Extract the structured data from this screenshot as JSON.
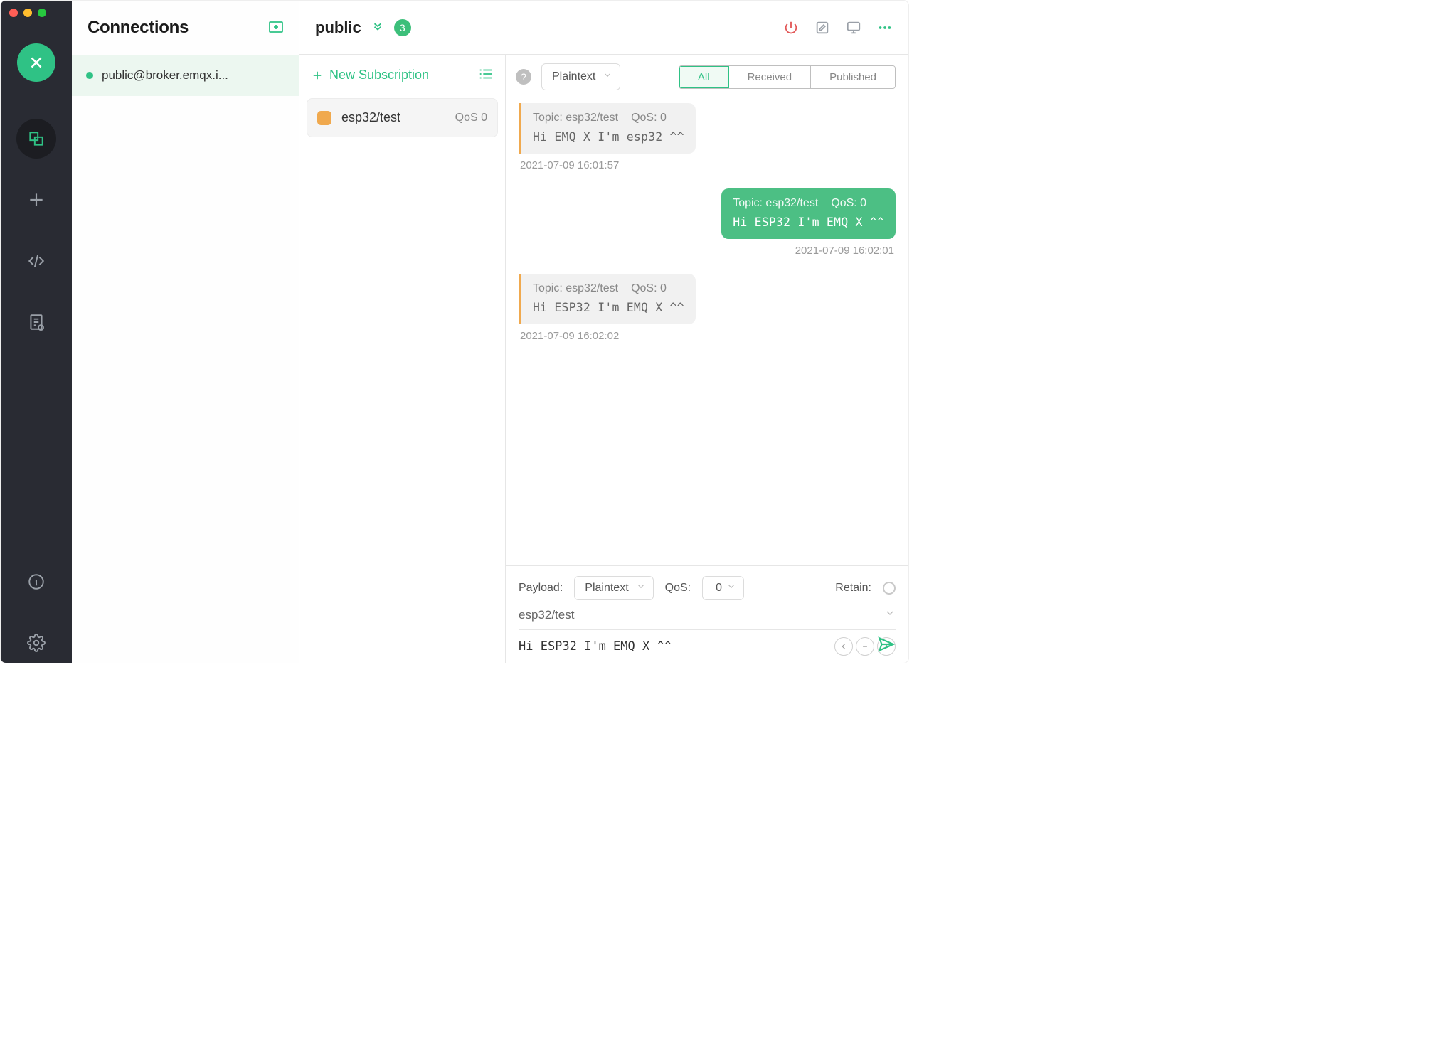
{
  "window": {
    "title": "Connections"
  },
  "sidebar": {
    "connections": [
      {
        "name": "public@broker.emqx.i...",
        "online": true,
        "active": true
      }
    ]
  },
  "topbar": {
    "title": "public",
    "unread": 3,
    "actions": {
      "disconnect": "Disconnect",
      "edit": "Edit",
      "display": "Display",
      "more": "More"
    }
  },
  "subscriptions": {
    "new_label": "New Subscription",
    "items": [
      {
        "topic": "esp32/test",
        "qos_label": "QoS 0",
        "color": "#f0a94e"
      }
    ]
  },
  "message_toolbar": {
    "format_select": "Plaintext",
    "segments": {
      "all": "All",
      "received": "Received",
      "published": "Published"
    },
    "active_segment": "all"
  },
  "messages": [
    {
      "direction": "in",
      "topic_label": "Topic: esp32/test",
      "qos_label": "QoS: 0",
      "payload": "Hi EMQ X I'm esp32 ^^",
      "timestamp": "2021-07-09 16:01:57"
    },
    {
      "direction": "out",
      "topic_label": "Topic: esp32/test",
      "qos_label": "QoS: 0",
      "payload": "Hi ESP32 I'm EMQ X ^^",
      "timestamp": "2021-07-09 16:02:01"
    },
    {
      "direction": "in",
      "topic_label": "Topic: esp32/test",
      "qos_label": "QoS: 0",
      "payload": "Hi ESP32 I'm EMQ X ^^",
      "timestamp": "2021-07-09 16:02:02"
    }
  ],
  "composer": {
    "payload_label": "Payload:",
    "payload_format": "Plaintext",
    "qos_label": "QoS:",
    "qos_value": "0",
    "retain_label": "Retain:",
    "topic": "esp32/test",
    "payload_text": "Hi ESP32 I'm EMQ X ^^"
  }
}
